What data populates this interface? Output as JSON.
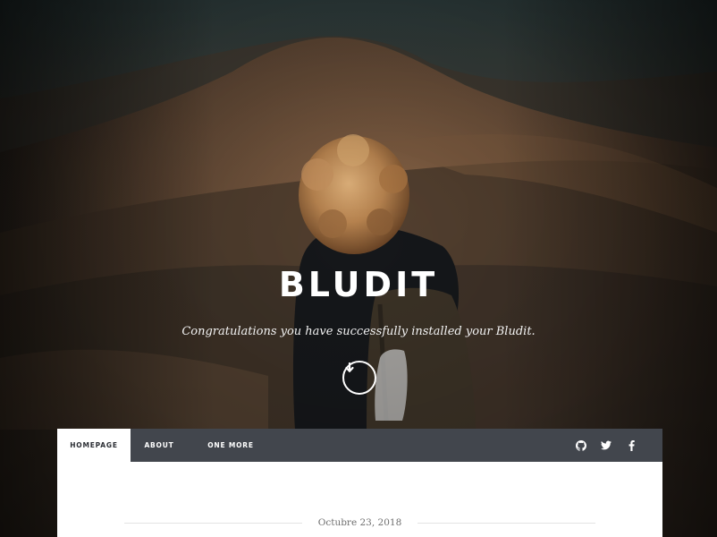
{
  "site": {
    "title": "BLUDIT",
    "slogan": "Congratulations you have successfully installed your Bludit."
  },
  "hero": {
    "scroll_icon": "arrow-down-circle-icon"
  },
  "navbar": {
    "tabs": [
      {
        "label": "HOMEPAGE",
        "active": true
      },
      {
        "label": "ABOUT",
        "active": false
      },
      {
        "label": "ONE MORE",
        "active": false
      }
    ],
    "social": [
      {
        "icon": "github-icon"
      },
      {
        "icon": "twitter-icon"
      },
      {
        "icon": "facebook-icon"
      }
    ]
  },
  "post": {
    "date": "Octubre 23, 2018"
  },
  "colors": {
    "navbar_bg": "#42464d",
    "active_tab_bg": "#ffffff",
    "content_bg": "#ffffff"
  }
}
